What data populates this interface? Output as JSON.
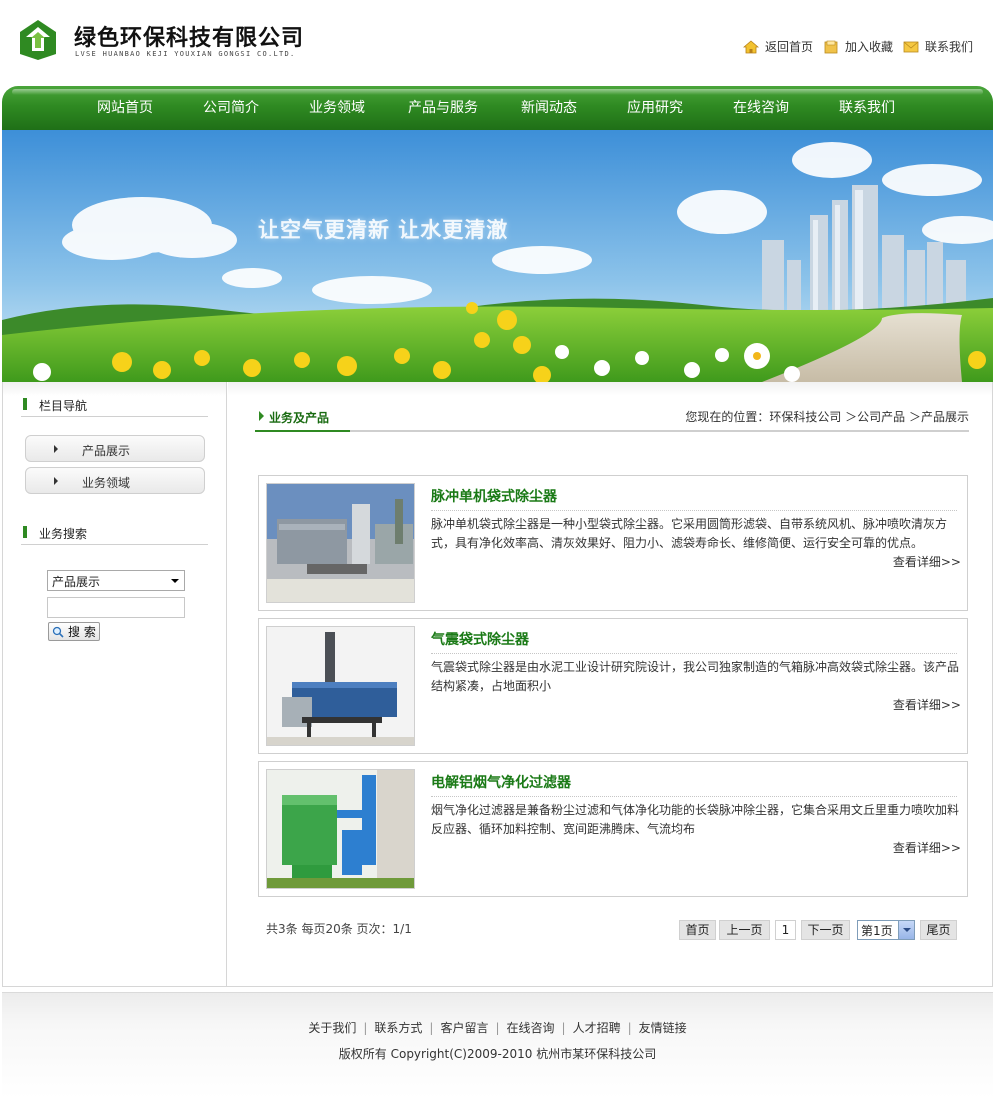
{
  "header": {
    "company_cn": "绿色环保科技有限公司",
    "company_en": "LVSE HUANBAO KEJI YOUXIAN GONGSI CO.LTD.",
    "links": [
      {
        "label": "返回首页",
        "icon": "home-icon"
      },
      {
        "label": "加入收藏",
        "icon": "folder-icon"
      },
      {
        "label": "联系我们",
        "icon": "mail-icon"
      }
    ]
  },
  "nav": {
    "items": [
      "网站首页",
      "公司简介",
      "业务领域",
      "产品与服务",
      "新闻动态",
      "应用研究",
      "在线咨询",
      "联系我们"
    ]
  },
  "banner": {
    "slogan": "让空气更清新  让水更清澈"
  },
  "sidebar": {
    "nav_title": "栏目导航",
    "nav_items": [
      "产品展示",
      "业务领域"
    ],
    "search_title": "业务搜索",
    "search_select": "产品展示",
    "search_input": "",
    "search_button": "搜 索"
  },
  "content": {
    "section_title": "业务及产品",
    "breadcrumb": "您现在的位置：环保科技公司 ＞公司产品 ＞产品展示",
    "products": [
      {
        "title": "脉冲单机袋式除尘器",
        "desc": "脉冲单机袋式除尘器是一种小型袋式除尘器。它采用圆筒形滤袋、自带系统风机、脉冲喷吹清灰方式，具有净化效率高、清灰效果好、阻力小、滤袋寿命长、维修简便、运行安全可靠的优点。",
        "more": "查看详细>>"
      },
      {
        "title": "气震袋式除尘器",
        "desc": "气震袋式除尘器是由水泥工业设计研究院设计，我公司独家制造的气箱脉冲高效袋式除尘器。该产品结构紧凑，占地面积小",
        "more": "查看详细>>"
      },
      {
        "title": "电解铝烟气净化过滤器",
        "desc": "烟气净化过滤器是兼备粉尘过滤和气体净化功能的长袋脉冲除尘器，它集合采用文丘里重力喷吹加料反应器、循环加料控制、宽间距沸腾床、气流均布",
        "more": "查看详细>>"
      }
    ],
    "pager": {
      "info": "共3条  每页20条  页次：1/1",
      "first": "首页",
      "prev": "上一页",
      "current": "1",
      "next": "下一页",
      "select": "第1页",
      "last": "尾页"
    }
  },
  "footer": {
    "links": [
      "关于我们",
      "联系方式",
      "客户留言",
      "在线咨询",
      "人才招聘",
      "友情链接"
    ],
    "copyright": "版权所有  Copyright(C)2009-2010 杭州市某环保科技公司"
  },
  "colors": {
    "brand_green": "#2f8a22",
    "title_green": "#1a7a16"
  }
}
